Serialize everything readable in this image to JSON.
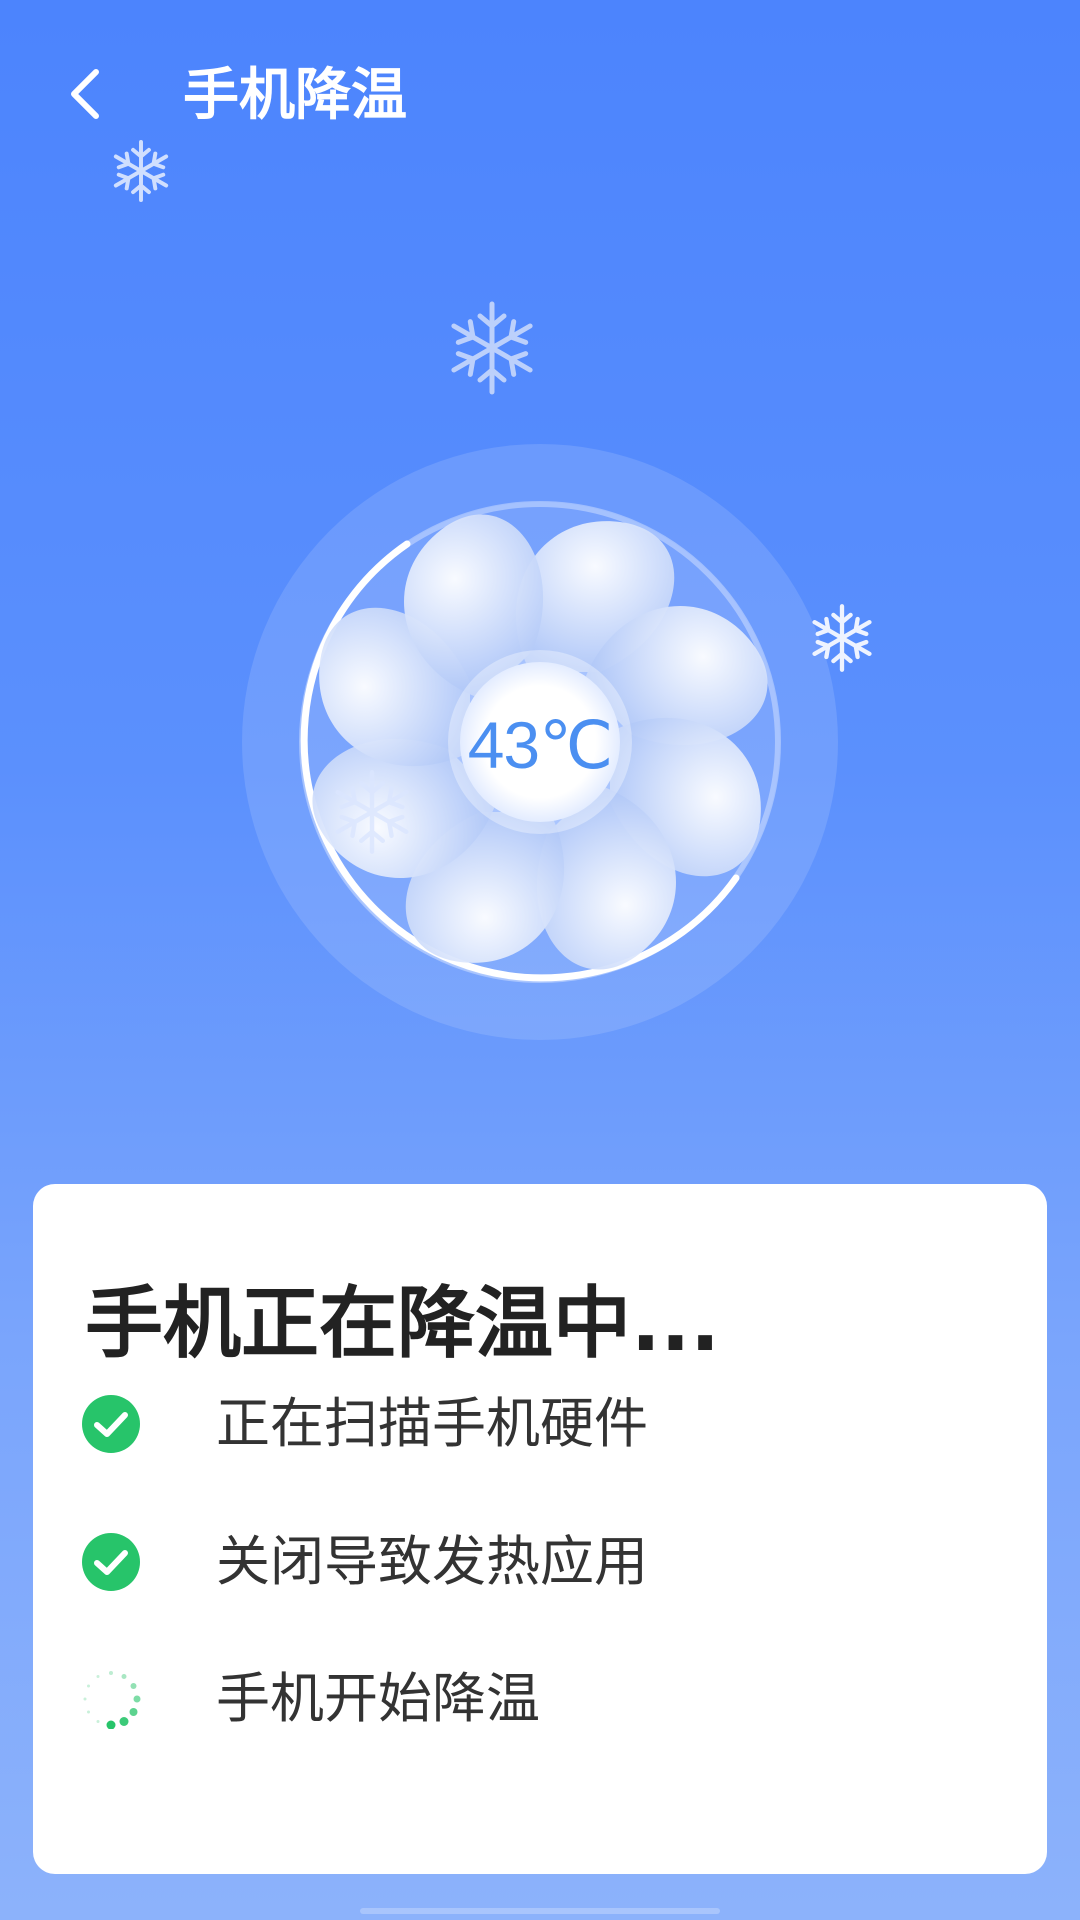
{
  "header": {
    "title": "手机降温",
    "back_icon": "chevron-left-icon"
  },
  "fan": {
    "temperature": "43℃",
    "icon": "fan-icon"
  },
  "status_card": {
    "heading": "手机正在降温中...",
    "steps": [
      {
        "label": "正在扫描手机硬件",
        "status": "done",
        "icon": "check-circle-icon"
      },
      {
        "label": "关闭导致发热应用",
        "status": "done",
        "icon": "check-circle-icon"
      },
      {
        "label": "手机开始降温",
        "status": "in-progress",
        "icon": "loading-spinner-icon"
      }
    ]
  },
  "colors": {
    "background_top": "#4c84fd",
    "background_bottom": "#8cb2fb",
    "check_green": "#27c46a",
    "temperature_text": "#4b8ff1"
  }
}
